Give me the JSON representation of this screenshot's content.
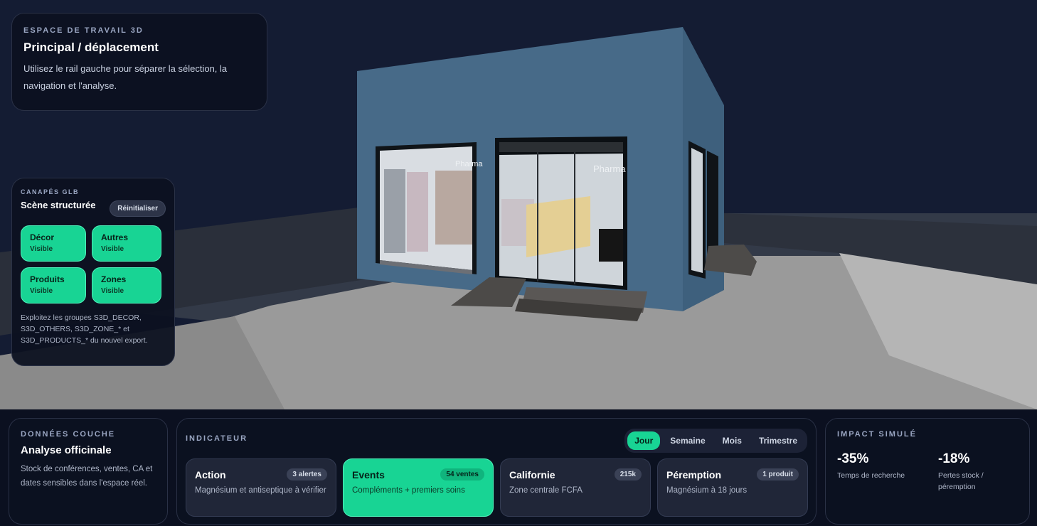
{
  "workspace": {
    "eyebrow": "ESPACE DE TRAVAIL 3D",
    "title": "Principal / déplacement",
    "description": "Utilisez le rail gauche pour séparer la sélection, la navigation et l'analyse."
  },
  "scene": {
    "storefront_sign": "Pharma"
  },
  "layers": {
    "eyebrow": "CANAPÉS GLB",
    "title": "Scène structurée",
    "reset_label": "Réinitialiser",
    "items": [
      {
        "name": "Décor",
        "state": "Visible"
      },
      {
        "name": "Autres",
        "state": "Visible"
      },
      {
        "name": "Produits",
        "state": "Visible"
      },
      {
        "name": "Zones",
        "state": "Visible"
      }
    ],
    "footnote": "Exploitez les groupes S3D_DECOR, S3D_OTHERS, S3D_ZONE_* et S3D_PRODUCTS_* du nouvel export."
  },
  "data_layer": {
    "eyebrow": "DONNÉES COUCHE",
    "title": "Analyse officinale",
    "description": "Stock de conférences, ventes, CA et dates sensibles dans l'espace réel."
  },
  "indicator": {
    "eyebrow": "INDICATEUR",
    "periods": [
      "Jour",
      "Semaine",
      "Mois",
      "Trimestre"
    ],
    "active_period": "Jour",
    "cards": [
      {
        "name": "Action",
        "badge": "3 alertes",
        "sub": "Magnésium et antiseptique à vérifier",
        "active": false
      },
      {
        "name": "Events",
        "badge": "54 ventes",
        "sub": "Compléments + premiers soins",
        "active": true
      },
      {
        "name": "Californie",
        "badge": "215k",
        "sub": "Zone centrale FCFA",
        "active": false
      },
      {
        "name": "Péremption",
        "badge": "1 produit",
        "sub": "Magnésium à 18 jours",
        "active": false
      }
    ]
  },
  "impact": {
    "eyebrow": "IMPACT SIMULÉ",
    "metrics": [
      {
        "value": "-35%",
        "label": "Temps de recherche"
      },
      {
        "value": "-18%",
        "label": "Pertes stock / péremption"
      }
    ]
  },
  "colors": {
    "accent": "#18d494",
    "panel": "#0c1120",
    "building": "#456884"
  }
}
